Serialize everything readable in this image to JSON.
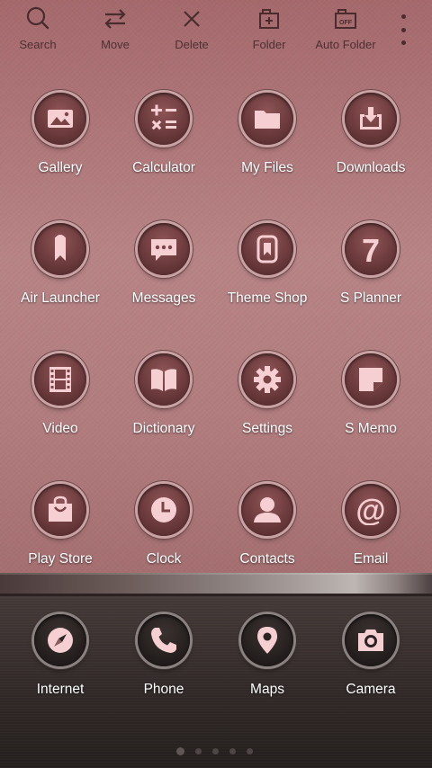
{
  "toolbar": {
    "items": [
      {
        "label": "Search",
        "icon": "search-icon"
      },
      {
        "label": "Move",
        "icon": "move-icon"
      },
      {
        "label": "Delete",
        "icon": "close-icon"
      },
      {
        "label": "Folder",
        "icon": "folder-add-icon"
      },
      {
        "label": "Auto Folder",
        "icon": "auto-folder-icon",
        "badge": "OFF"
      }
    ],
    "more_icon": "more-vertical-icon"
  },
  "apps": [
    {
      "label": "Gallery",
      "icon": "gallery-icon"
    },
    {
      "label": "Calculator",
      "icon": "calculator-icon"
    },
    {
      "label": "My Files",
      "icon": "folder-icon"
    },
    {
      "label": "Downloads",
      "icon": "download-icon"
    },
    {
      "label": "Air Launcher",
      "icon": "bookmark-icon"
    },
    {
      "label": "Messages",
      "icon": "message-icon"
    },
    {
      "label": "Theme Shop",
      "icon": "theme-shop-icon"
    },
    {
      "label": "S Planner",
      "icon": "calendar-7-icon",
      "glyph": "7"
    },
    {
      "label": "Video",
      "icon": "film-icon"
    },
    {
      "label": "Dictionary",
      "icon": "book-icon"
    },
    {
      "label": "Settings",
      "icon": "gear-icon"
    },
    {
      "label": "S Memo",
      "icon": "memo-icon"
    },
    {
      "label": "Play Store",
      "icon": "shopping-bag-icon"
    },
    {
      "label": "Clock",
      "icon": "clock-icon"
    },
    {
      "label": "Contacts",
      "icon": "person-icon"
    },
    {
      "label": "Email",
      "icon": "at-icon",
      "glyph": "@"
    }
  ],
  "dock": [
    {
      "label": "Internet",
      "icon": "compass-icon"
    },
    {
      "label": "Phone",
      "icon": "phone-icon"
    },
    {
      "label": "Maps",
      "icon": "map-pin-icon"
    },
    {
      "label": "Camera",
      "icon": "camera-icon"
    }
  ],
  "pager": {
    "count": 5,
    "active_index": 0
  },
  "colors": {
    "icon_fill": "#f6cfd3",
    "toolbar_ink": "#4a2c2e",
    "label_text": "#ffffff"
  }
}
